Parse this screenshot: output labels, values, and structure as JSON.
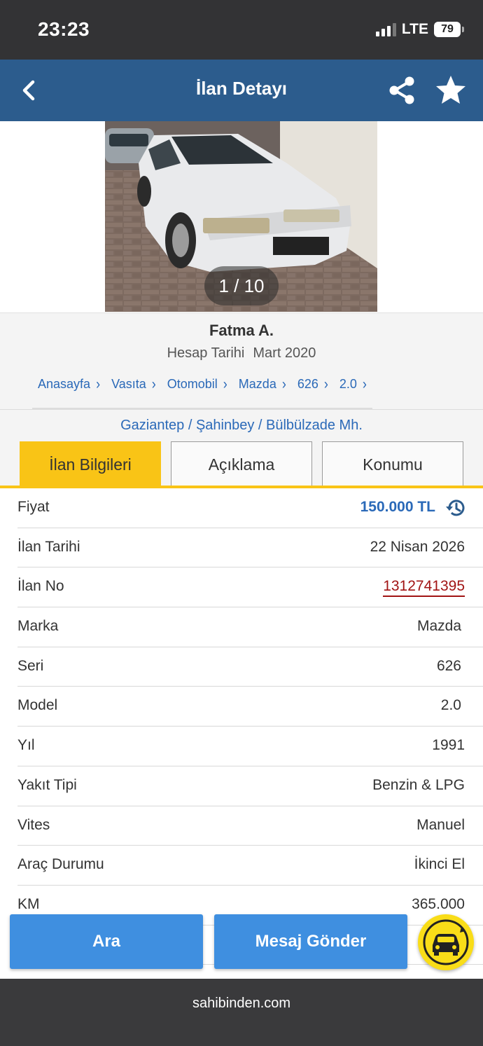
{
  "status_bar": {
    "time": "23:23",
    "network": "LTE",
    "battery": "79"
  },
  "header": {
    "title": "İlan Detayı",
    "back_icon": "chevron-left-icon",
    "share_icon": "share-icon",
    "favorite_icon": "star-icon"
  },
  "gallery": {
    "counter": "1 / 10"
  },
  "seller": {
    "name": "Fatma A.",
    "account_label": "Hesap Tarihi",
    "account_date": "Mart 2020"
  },
  "breadcrumb": [
    {
      "label": "Anasayfa"
    },
    {
      "label": "Vasıta"
    },
    {
      "label": "Otomobil"
    },
    {
      "label": "Mazda"
    },
    {
      "label": "626"
    },
    {
      "label": "2.0"
    }
  ],
  "location": "Gaziantep / Şahinbey / Bülbülzade Mh.",
  "tabs": [
    {
      "label": "İlan Bilgileri",
      "active": true
    },
    {
      "label": "Açıklama",
      "active": false
    },
    {
      "label": "Konumu",
      "active": false
    }
  ],
  "details": [
    {
      "label": "Fiyat",
      "value": "150.000 TL"
    },
    {
      "label": "İlan Tarihi",
      "value": "22 Nisan 2026"
    },
    {
      "label": "İlan No",
      "value": "1312741395"
    },
    {
      "label": "Marka",
      "value": "Mazda"
    },
    {
      "label": "Seri",
      "value": "626"
    },
    {
      "label": "Model",
      "value": "2.0"
    },
    {
      "label": "Yıl",
      "value": "1991"
    },
    {
      "label": "Yakıt Tipi",
      "value": "Benzin & LPG"
    },
    {
      "label": "Vites",
      "value": "Manuel"
    },
    {
      "label": "Araç Durumu",
      "value": "İkinci El"
    },
    {
      "label": "KM",
      "value": "365.000"
    }
  ],
  "actions": {
    "call": "Ara",
    "message": "Mesaj Gönder"
  },
  "footer": {
    "domain": "sahibinden.com"
  },
  "colors": {
    "header": "#2c5c8d",
    "accent_yellow": "#f9c416",
    "link_blue": "#2a69b8",
    "button_blue": "#3f8fe0",
    "ad_no_red": "#a11414"
  }
}
